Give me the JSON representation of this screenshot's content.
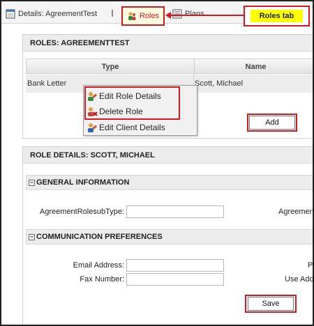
{
  "tabs": {
    "details_label": "Details: AgreementTest",
    "roles_label": "Roles",
    "plans_label": "Plans",
    "callout_label": "Roles tab"
  },
  "roles": {
    "header": "ROLES: AGREEMENTTEST",
    "columns": [
      "Type",
      "Name"
    ],
    "rows": [
      {
        "type": "Bank Letter",
        "name": "Scott, Michael"
      }
    ],
    "add_label": "Add"
  },
  "context_menu": {
    "items": [
      "Edit Role Details",
      "Delete Role",
      "Edit Client Details"
    ]
  },
  "role_details": {
    "header": "ROLE DETAILS: SCOTT, MICHAEL",
    "general": {
      "title": "GENERAL INFORMATION",
      "subtype_label": "AgreementRolesubType:",
      "subtype_value": "",
      "right_label": "Agreement"
    },
    "communication": {
      "title": "COMMUNICATION PREFERENCES",
      "email_label": "Email Address:",
      "email_value": "",
      "fax_label": "Fax Number:",
      "fax_value": "",
      "right_label_1": "P",
      "right_label_2": "Use Add"
    },
    "save_label": "Save"
  },
  "colors": {
    "highlight": "#d4181f",
    "callout_bg": "#ffff00",
    "panel_header": "#ececec"
  }
}
